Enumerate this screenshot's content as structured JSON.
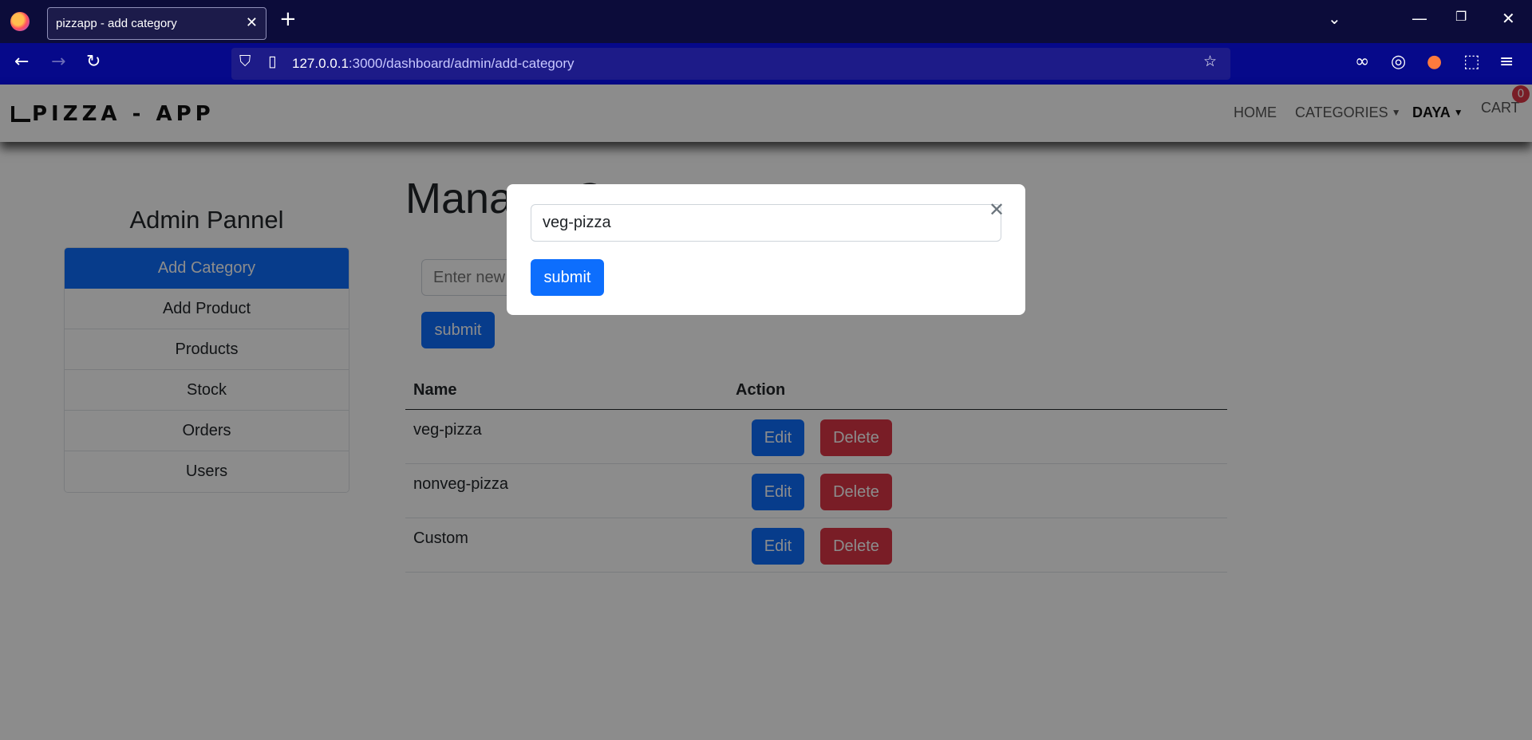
{
  "browser": {
    "tab_title": "pizzapp - add category",
    "url_host": "127.0.0.1",
    "url_path": ":3000/dashboard/admin/add-category"
  },
  "header": {
    "brand": "PIZZA - APP",
    "menu": {
      "home": "HOME",
      "categories": "CATEGORIES",
      "user": "DAYA",
      "cart": "CART",
      "cart_count": "0"
    }
  },
  "sidebar": {
    "title": "Admin Pannel",
    "items": [
      {
        "label": "Add Category"
      },
      {
        "label": "Add Product"
      },
      {
        "label": "Products"
      },
      {
        "label": "Stock"
      },
      {
        "label": "Orders"
      },
      {
        "label": "Users"
      }
    ]
  },
  "main": {
    "title": "Manage Category",
    "input_placeholder": "Enter new category",
    "submit_label": "submit",
    "table": {
      "headers": [
        "Name",
        "Action"
      ],
      "rows": [
        {
          "name": "veg-pizza"
        },
        {
          "name": "nonveg-pizza"
        },
        {
          "name": "Custom"
        }
      ],
      "edit_label": "Edit",
      "delete_label": "Delete"
    }
  },
  "modal": {
    "input_value": "veg-pizza",
    "submit_label": "submit"
  },
  "colors": {
    "primary": "#0d6efd",
    "danger": "#dc3545",
    "chrome_dark": "#0c0c3a",
    "chrome_nav": "#06098a"
  }
}
